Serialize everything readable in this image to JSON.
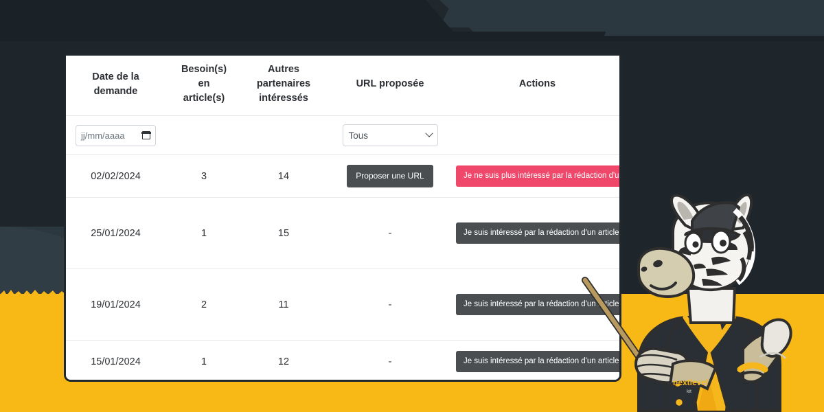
{
  "page": {
    "background_dark": "#1b2227",
    "background_slate": "#2c3840",
    "accent_yellow": "#f8b916",
    "card_border": "#21282d"
  },
  "table": {
    "headers": [
      {
        "id": "date",
        "label": "Date de la demande"
      },
      {
        "id": "needs",
        "label": "Besoin(s) en article(s)"
      },
      {
        "id": "partners",
        "label": "Autres partenaires intéressés"
      },
      {
        "id": "url",
        "label": "URL proposée"
      },
      {
        "id": "actions",
        "label": "Actions"
      }
    ],
    "header_lines": {
      "date": [
        "Date de la",
        "demande"
      ],
      "needs": [
        "Besoin(s)",
        "en",
        "article(s)"
      ],
      "partners": [
        "Autres",
        "partenaires",
        "intéressés"
      ],
      "url": [
        "URL proposée"
      ],
      "actions": [
        "Actions"
      ]
    },
    "filters": {
      "date_placeholder": "jj/mm/aaaa",
      "date_value": "",
      "url_select_value": "Tous",
      "url_select_options": [
        "Tous"
      ],
      "calendar_icon": "calendar-icon",
      "chevron_icon": "chevron-down-icon"
    },
    "rows": [
      {
        "date": "02/02/2024",
        "needs": "3",
        "partners": "14",
        "url_label": "Proposer une URL",
        "url_is_button": true,
        "action_label": "Je ne suis plus intéressé par la rédaction d'un article à ce sujet",
        "action_style": "danger"
      },
      {
        "date": "25/01/2024",
        "needs": "1",
        "partners": "15",
        "url_label": "-",
        "url_is_button": false,
        "action_label": "Je suis intéressé par la rédaction d'un article à ce sujet",
        "action_style": "dark"
      },
      {
        "date": "19/01/2024",
        "needs": "2",
        "partners": "11",
        "url_label": "-",
        "url_is_button": false,
        "action_label": "Je suis intéressé par la rédaction d'un article à ce sujet",
        "action_style": "dark"
      },
      {
        "date": "15/01/2024",
        "needs": "1",
        "partners": "12",
        "url_label": "-",
        "url_is_button": false,
        "action_label": "Je suis intéressé par la rédaction d'un article à ce sujet",
        "action_style": "dark"
      }
    ]
  },
  "mascot": {
    "name": "zebra-mascot",
    "jacket_text": "nextlevel",
    "jacket_subtext": "kit",
    "pointer": "pointer-stick"
  }
}
